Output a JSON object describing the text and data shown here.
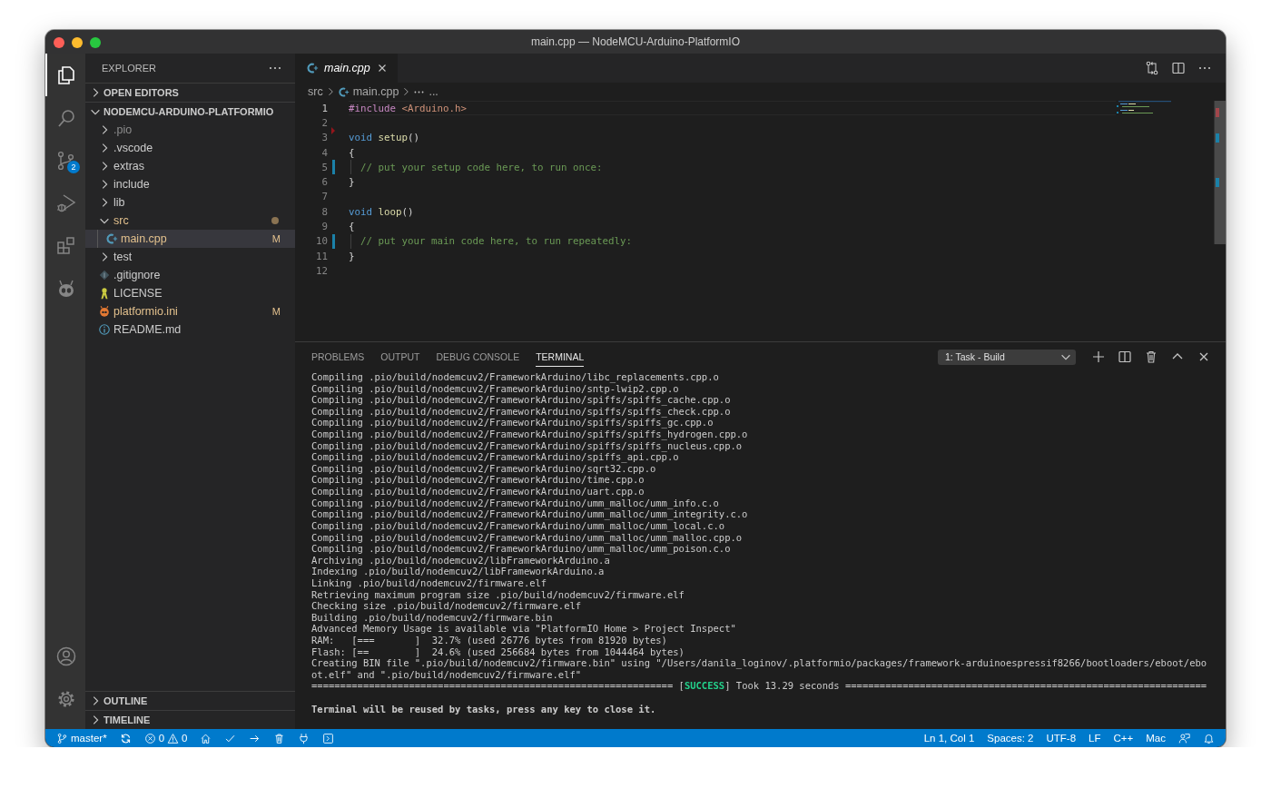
{
  "window": {
    "title": "main.cpp — NodeMCU-Arduino-PlatformIO"
  },
  "activity_bar": {
    "top": [
      {
        "kind": "explorer",
        "selected": true
      },
      {
        "kind": "search",
        "selected": false
      },
      {
        "kind": "scm",
        "selected": false,
        "badge": "2"
      },
      {
        "kind": "debug",
        "selected": false
      },
      {
        "kind": "extensions",
        "selected": false
      },
      {
        "kind": "platformio",
        "selected": false
      }
    ],
    "bottom": [
      {
        "kind": "account"
      },
      {
        "kind": "settings"
      }
    ]
  },
  "sidebar": {
    "title": "EXPLORER",
    "sections": [
      {
        "title": "OPEN EDITORS",
        "expanded": false
      },
      {
        "title": "NODEMCU-ARDUINO-PLATFORMIO",
        "expanded": true,
        "items": [
          {
            "label": ".pio",
            "kind": "folder",
            "expanded": false,
            "selected": false,
            "ignored": true,
            "modified": false
          },
          {
            "label": ".vscode",
            "kind": "folder",
            "expanded": false,
            "selected": false,
            "ignored": false,
            "modified": false
          },
          {
            "label": "extras",
            "kind": "folder",
            "expanded": false,
            "selected": false,
            "ignored": false,
            "modified": false
          },
          {
            "label": "include",
            "kind": "folder",
            "expanded": false,
            "selected": false,
            "ignored": false,
            "modified": false
          },
          {
            "label": "lib",
            "kind": "folder",
            "expanded": false,
            "selected": false,
            "ignored": false,
            "modified": false
          },
          {
            "label": "src",
            "kind": "folder",
            "expanded": true,
            "selected": false,
            "ignored": false,
            "modified": true,
            "children": [
              {
                "label": "main.cpp",
                "kind": "cpp",
                "selected": true,
                "ignored": false,
                "modified": true,
                "badge": "M"
              }
            ]
          },
          {
            "label": "test",
            "kind": "folder",
            "expanded": false,
            "selected": false,
            "ignored": false,
            "modified": false
          },
          {
            "label": ".gitignore",
            "kind": "gitignore",
            "selected": false,
            "ignored": false,
            "modified": false
          },
          {
            "label": "LICENSE",
            "kind": "license",
            "selected": false,
            "ignored": false,
            "modified": false
          },
          {
            "label": "platformio.ini",
            "kind": "ini",
            "selected": false,
            "ignored": false,
            "modified": true,
            "badge": "M"
          },
          {
            "label": "README.md",
            "kind": "markdown",
            "selected": false,
            "ignored": false,
            "modified": false
          }
        ]
      },
      {
        "title": "OUTLINE",
        "expanded": false
      },
      {
        "title": "TIMELINE",
        "expanded": false
      }
    ]
  },
  "editor": {
    "tabs": [
      {
        "label": "main.cpp",
        "kind": "cpp",
        "selected": true,
        "preview": true
      }
    ],
    "breadcrumbs": [
      {
        "text": "src",
        "kind": "folder"
      },
      {
        "text": "main.cpp",
        "kind": "cpp"
      },
      {
        "text": "...",
        "kind": "more"
      }
    ],
    "lines": [
      {
        "number": "1",
        "current": true,
        "tokens": [
          {
            "text": "#include ",
            "kind": "directive"
          },
          {
            "text": "<Arduino.h>",
            "kind": "string"
          }
        ]
      },
      {
        "number": "2",
        "current": false,
        "deleted": true
      },
      {
        "number": "3",
        "current": false,
        "tokens": [
          {
            "text": "void ",
            "kind": "keyword"
          },
          {
            "text": "setup",
            "kind": "function"
          },
          {
            "text": "()",
            "kind": "punct"
          }
        ]
      },
      {
        "number": "4",
        "current": false,
        "tokens": [
          {
            "text": "{",
            "kind": "punct"
          }
        ]
      },
      {
        "number": "5",
        "current": false,
        "modified": true,
        "indent_guide": true,
        "tokens": [
          {
            "text": "  // put your setup code here, to run once:",
            "kind": "comment"
          }
        ]
      },
      {
        "number": "6",
        "current": false,
        "tokens": [
          {
            "text": "}",
            "kind": "punct"
          }
        ]
      },
      {
        "number": "7",
        "current": false
      },
      {
        "number": "8",
        "current": false,
        "tokens": [
          {
            "text": "void ",
            "kind": "keyword"
          },
          {
            "text": "loop",
            "kind": "function"
          },
          {
            "text": "()",
            "kind": "punct"
          }
        ]
      },
      {
        "number": "9",
        "current": false,
        "tokens": [
          {
            "text": "{",
            "kind": "punct"
          }
        ]
      },
      {
        "number": "10",
        "current": false,
        "modified": true,
        "indent_guide": true,
        "tokens": [
          {
            "text": "  // put your main code here, to run repeatedly:",
            "kind": "comment"
          }
        ]
      },
      {
        "number": "11",
        "current": false,
        "tokens": [
          {
            "text": "}",
            "kind": "punct"
          }
        ]
      },
      {
        "number": "12",
        "current": false
      }
    ]
  },
  "panel": {
    "tabs": [
      {
        "label": "PROBLEMS",
        "selected": false
      },
      {
        "label": "OUTPUT",
        "selected": false
      },
      {
        "label": "DEBUG CONSOLE",
        "selected": false
      },
      {
        "label": "TERMINAL",
        "selected": true
      }
    ],
    "terminal_select": "1: Task - Build",
    "lines": [
      {
        "kind": "plain",
        "text": "Compiling .pio/build/nodemcuv2/FrameworkArduino/libc_replacements.cpp.o"
      },
      {
        "kind": "plain",
        "text": "Compiling .pio/build/nodemcuv2/FrameworkArduino/sntp-lwip2.cpp.o"
      },
      {
        "kind": "plain",
        "text": "Compiling .pio/build/nodemcuv2/FrameworkArduino/spiffs/spiffs_cache.cpp.o"
      },
      {
        "kind": "plain",
        "text": "Compiling .pio/build/nodemcuv2/FrameworkArduino/spiffs/spiffs_check.cpp.o"
      },
      {
        "kind": "plain",
        "text": "Compiling .pio/build/nodemcuv2/FrameworkArduino/spiffs/spiffs_gc.cpp.o"
      },
      {
        "kind": "plain",
        "text": "Compiling .pio/build/nodemcuv2/FrameworkArduino/spiffs/spiffs_hydrogen.cpp.o"
      },
      {
        "kind": "plain",
        "text": "Compiling .pio/build/nodemcuv2/FrameworkArduino/spiffs/spiffs_nucleus.cpp.o"
      },
      {
        "kind": "plain",
        "text": "Compiling .pio/build/nodemcuv2/FrameworkArduino/spiffs_api.cpp.o"
      },
      {
        "kind": "plain",
        "text": "Compiling .pio/build/nodemcuv2/FrameworkArduino/sqrt32.cpp.o"
      },
      {
        "kind": "plain",
        "text": "Compiling .pio/build/nodemcuv2/FrameworkArduino/time.cpp.o"
      },
      {
        "kind": "plain",
        "text": "Compiling .pio/build/nodemcuv2/FrameworkArduino/uart.cpp.o"
      },
      {
        "kind": "plain",
        "text": "Compiling .pio/build/nodemcuv2/FrameworkArduino/umm_malloc/umm_info.c.o"
      },
      {
        "kind": "plain",
        "text": "Compiling .pio/build/nodemcuv2/FrameworkArduino/umm_malloc/umm_integrity.c.o"
      },
      {
        "kind": "plain",
        "text": "Compiling .pio/build/nodemcuv2/FrameworkArduino/umm_malloc/umm_local.c.o"
      },
      {
        "kind": "plain",
        "text": "Compiling .pio/build/nodemcuv2/FrameworkArduino/umm_malloc/umm_malloc.cpp.o"
      },
      {
        "kind": "plain",
        "text": "Compiling .pio/build/nodemcuv2/FrameworkArduino/umm_malloc/umm_poison.c.o"
      },
      {
        "kind": "plain",
        "text": "Archiving .pio/build/nodemcuv2/libFrameworkArduino.a"
      },
      {
        "kind": "plain",
        "text": "Indexing .pio/build/nodemcuv2/libFrameworkArduino.a"
      },
      {
        "kind": "plain",
        "text": "Linking .pio/build/nodemcuv2/firmware.elf"
      },
      {
        "kind": "plain",
        "text": "Retrieving maximum program size .pio/build/nodemcuv2/firmware.elf"
      },
      {
        "kind": "plain",
        "text": "Checking size .pio/build/nodemcuv2/firmware.elf"
      },
      {
        "kind": "plain",
        "text": "Building .pio/build/nodemcuv2/firmware.bin"
      },
      {
        "kind": "plain",
        "text": "Advanced Memory Usage is available via \"PlatformIO Home > Project Inspect\""
      },
      {
        "kind": "plain",
        "text": "RAM:   [===       ]  32.7% (used 26776 bytes from 81920 bytes)"
      },
      {
        "kind": "plain",
        "text": "Flash: [==        ]  24.6% (used 256684 bytes from 1044464 bytes)"
      },
      {
        "kind": "plain",
        "text": "Creating BIN file \".pio/build/nodemcuv2/firmware.bin\" using \"/Users/danila_loginov/.platformio/packages/framework-arduinoespressif8266/bootloaders/eboot/ebo"
      },
      {
        "kind": "plain",
        "text": "ot.elf\" and \".pio/build/nodemcuv2/firmware.elf\""
      },
      {
        "kind": "result",
        "before": "=============================================================== [",
        "status": "SUCCESS",
        "after": "] Took 13.29 seconds ==============================================================="
      },
      {
        "kind": "notice",
        "text": "Terminal will be reused by tasks, press any key to close it."
      }
    ]
  },
  "status_bar": {
    "left": [
      {
        "kind": "branch",
        "text": "master*"
      },
      {
        "kind": "sync"
      },
      {
        "kind": "problems",
        "errors": "0",
        "warnings": "0"
      },
      {
        "kind": "home"
      },
      {
        "kind": "check"
      },
      {
        "kind": "arrow"
      },
      {
        "kind": "trash"
      },
      {
        "kind": "plug"
      },
      {
        "kind": "terminal"
      }
    ],
    "right": [
      {
        "kind": "text",
        "text": "Ln 1, Col 1"
      },
      {
        "kind": "text",
        "text": "Spaces: 2"
      },
      {
        "kind": "text",
        "text": "UTF-8"
      },
      {
        "kind": "text",
        "text": "LF"
      },
      {
        "kind": "text",
        "text": "C++"
      },
      {
        "kind": "text",
        "text": "Mac"
      },
      {
        "kind": "feedback"
      },
      {
        "kind": "bell"
      }
    ]
  }
}
